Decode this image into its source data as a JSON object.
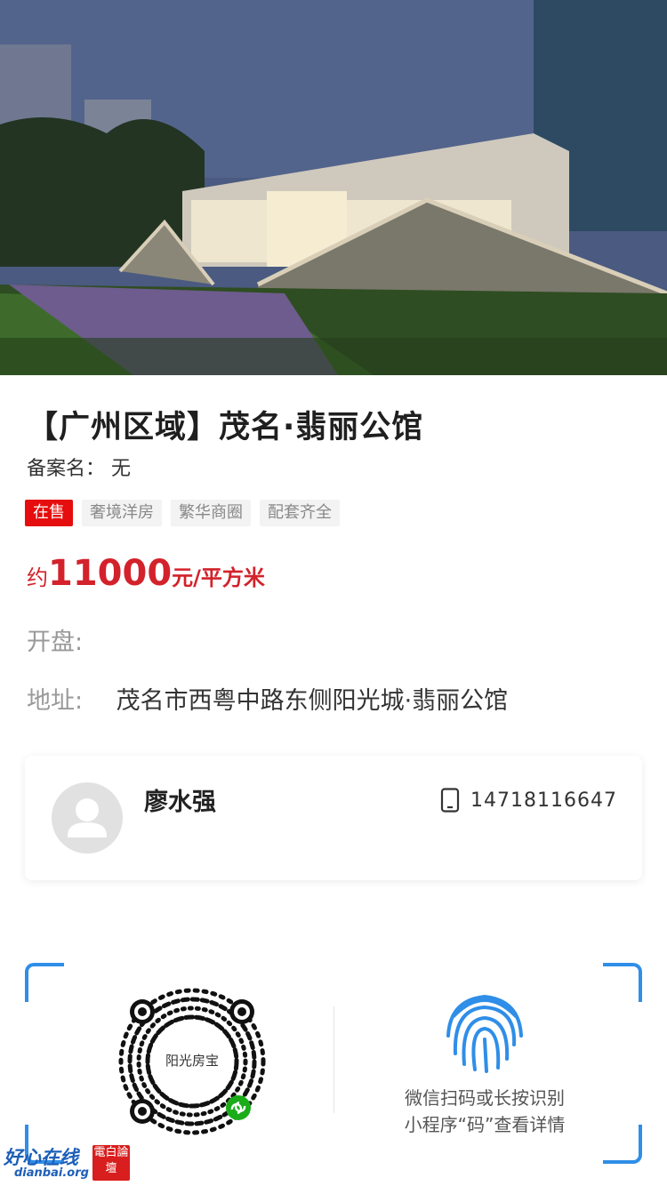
{
  "project": {
    "title": "【广州区域】茂名·翡丽公馆",
    "record_label": "备案名：",
    "record_value": "无",
    "tags": [
      "在售",
      "奢境洋房",
      "繁华商圈",
      "配套齐全"
    ],
    "price_prefix": "约",
    "price_value": "11000",
    "price_unit": "元/平方米",
    "opening_label": "开盘:",
    "opening_value": "",
    "address_label": "地址:",
    "address_value": "茂名市西粤中路东侧阳光城·翡丽公馆"
  },
  "agent": {
    "name": "廖水强",
    "phone": "14718116647"
  },
  "miniprogram": {
    "logo_text": "阳光房宝",
    "hint_line1": "微信扫码或长按识别",
    "hint_line2": "小程序“码”查看详情"
  },
  "watermark": {
    "main": "好心在线",
    "sub": "dianbai.org",
    "badge": "電白論壇"
  },
  "colors": {
    "accent_red": "#d3222b",
    "sale_tag_bg": "#e50d0d",
    "scan_blue": "#2f8ee8"
  }
}
